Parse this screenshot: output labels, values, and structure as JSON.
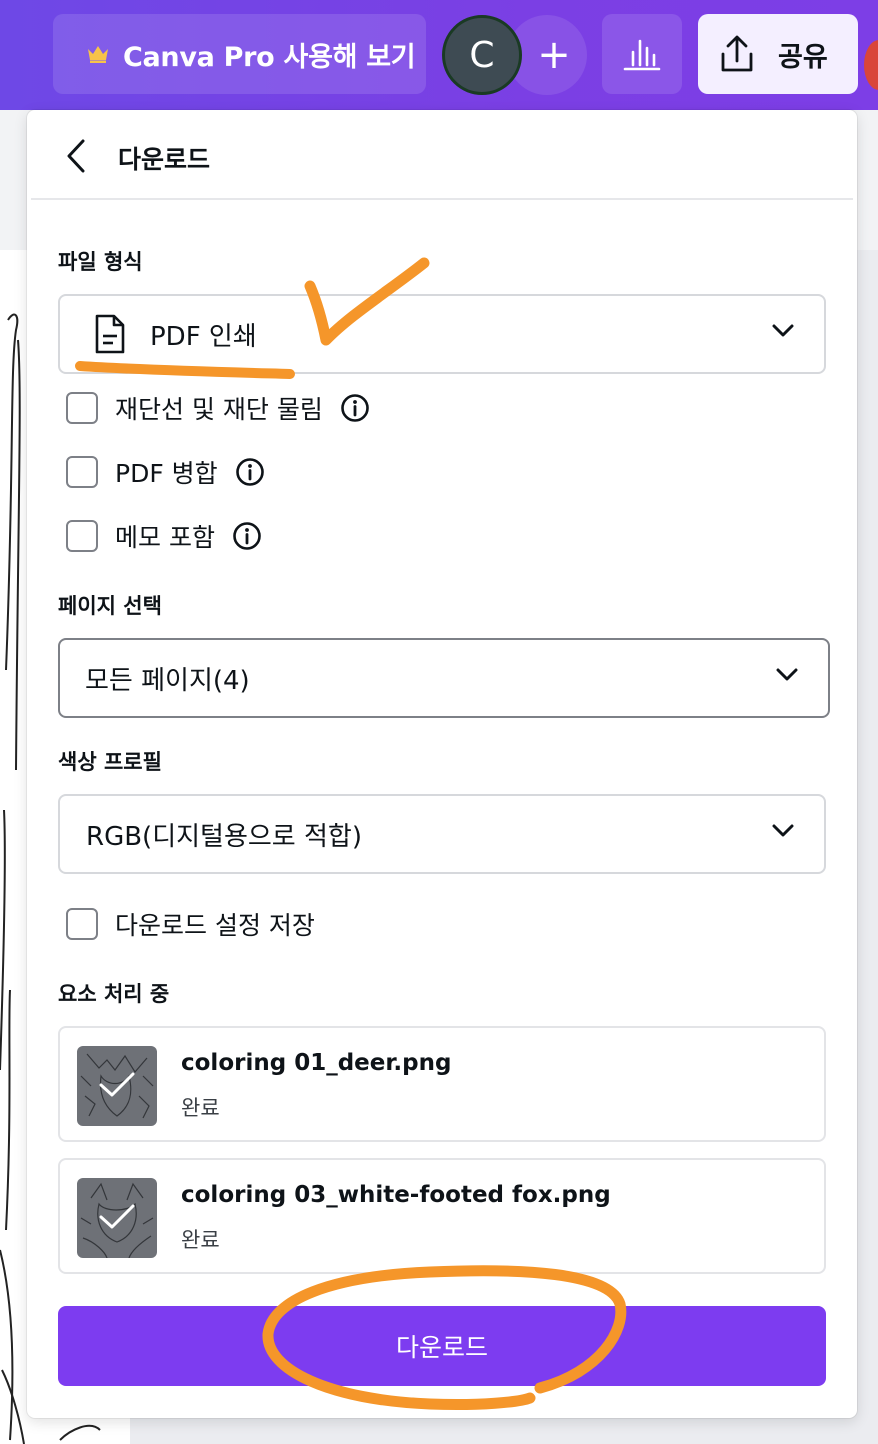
{
  "topbar": {
    "pro_label": "Canva Pro 사용해 보기",
    "avatar_initial": "C",
    "add_symbol": "+",
    "share_label": "공유",
    "icons": [
      "crown-icon",
      "bar-chart-icon",
      "share-upload-icon"
    ]
  },
  "panel": {
    "title": "다운로드",
    "file_type": {
      "label": "파일 형식",
      "value": "PDF 인쇄",
      "icon": "document-icon"
    },
    "options": [
      {
        "label": "재단선 및 재단 물림",
        "checked": false,
        "has_info": true
      },
      {
        "label": "PDF 병합",
        "checked": false,
        "has_info": true
      },
      {
        "label": "메모 포함",
        "checked": false,
        "has_info": true
      }
    ],
    "page_select": {
      "label": "페이지 선택",
      "value": "모든 페이지(4)"
    },
    "color_profile": {
      "label": "색상 프로필",
      "value": "RGB(디지털용으로 적합)"
    },
    "save_settings": {
      "label": "다운로드 설정 저장",
      "checked": false
    },
    "processing": {
      "label": "요소 처리 중",
      "files": [
        {
          "name": "coloring 01_deer.png",
          "status": "완료"
        },
        {
          "name": "coloring 03_white-footed fox.png",
          "status": "완료"
        }
      ]
    },
    "download_button": "다운로드"
  },
  "colors": {
    "topbar": "#7b3fe4",
    "accent": "#7d3cf0",
    "annotation": "#f5962a"
  }
}
